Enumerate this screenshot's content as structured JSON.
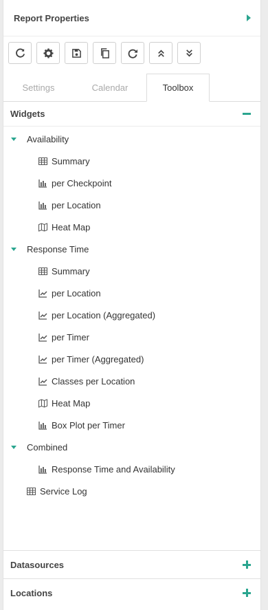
{
  "panel": {
    "title": "Report Properties"
  },
  "toolbar": {
    "buttons": [
      {
        "icon": "refresh-icon"
      },
      {
        "icon": "gear-icon"
      },
      {
        "icon": "save-icon"
      },
      {
        "icon": "copy-icon"
      },
      {
        "icon": "redo-icon"
      },
      {
        "icon": "collapse-all-icon"
      },
      {
        "icon": "expand-all-icon"
      }
    ]
  },
  "tabs": [
    "Settings",
    "Calendar",
    "Toolbox"
  ],
  "active_tab": "Toolbox",
  "widgets": {
    "label": "Widgets",
    "groups": [
      {
        "label": "Availability",
        "items": [
          {
            "label": "Summary",
            "icon": "table-icon"
          },
          {
            "label": "per Checkpoint",
            "icon": "bar-chart-icon"
          },
          {
            "label": "per Location",
            "icon": "bar-chart-icon"
          },
          {
            "label": "Heat Map",
            "icon": "map-icon"
          }
        ]
      },
      {
        "label": "Response Time",
        "items": [
          {
            "label": "Summary",
            "icon": "table-icon"
          },
          {
            "label": "per Location",
            "icon": "line-chart-icon"
          },
          {
            "label": "per Location (Aggregated)",
            "icon": "line-chart-icon"
          },
          {
            "label": "per Timer",
            "icon": "line-chart-icon"
          },
          {
            "label": "per Timer (Aggregated)",
            "icon": "line-chart-icon"
          },
          {
            "label": "Classes per Location",
            "icon": "line-chart-icon"
          },
          {
            "label": "Heat Map",
            "icon": "map-icon"
          },
          {
            "label": "Box Plot per Timer",
            "icon": "bar-chart-icon"
          }
        ]
      },
      {
        "label": "Combined",
        "items": [
          {
            "label": "Response Time and Availability",
            "icon": "bar-chart-icon"
          }
        ]
      }
    ],
    "service_log": {
      "label": "Service Log",
      "icon": "table-icon"
    }
  },
  "datasources": {
    "label": "Datasources"
  },
  "locations": {
    "label": "Locations"
  },
  "colors": {
    "accent": "#2aa58f"
  }
}
